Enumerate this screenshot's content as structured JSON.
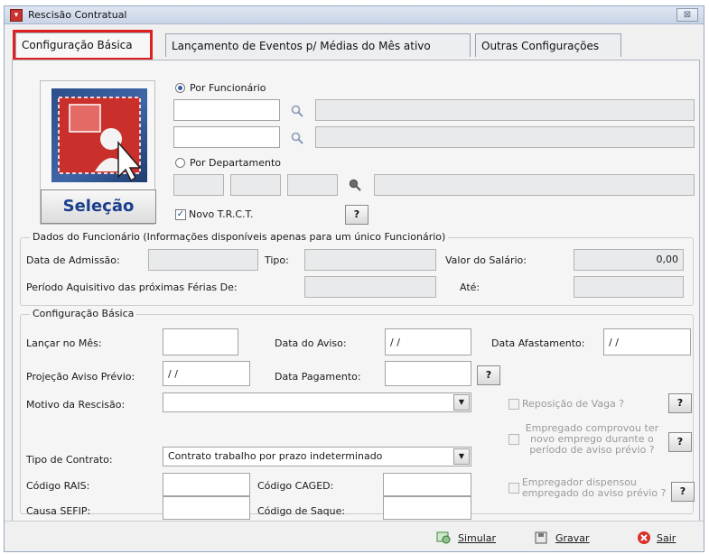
{
  "window": {
    "title": "Rescisão Contratual",
    "close_glyph": "⊠"
  },
  "tabs": [
    {
      "label": "Configuração Básica",
      "active": true
    },
    {
      "label": "Lançamento de Eventos p/ Médias do Mês ativo",
      "active": false
    },
    {
      "label": "Outras Configurações",
      "active": false
    }
  ],
  "selection": {
    "button_label": "Seleção"
  },
  "por_funcionario": {
    "label": "Por Funcionário",
    "checked": true,
    "code1": "",
    "code2": ""
  },
  "por_departamento": {
    "label": "Por Departamento",
    "checked": false
  },
  "novo_trct": {
    "label": "Novo T.R.C.T.",
    "checked": true
  },
  "help_label": "?",
  "dados_funcionario": {
    "title": "Dados do Funcionário (Informações disponíveis apenas para um único Funcionário)",
    "admissao_label": "Data de Admissão:",
    "tipo_label": "Tipo:",
    "salario_label": "Valor do Salário:",
    "salario_value": "0,00",
    "periodo_label": "Período Aquisitivo das próximas Férias De:",
    "ate_label": "Até:"
  },
  "config_basica": {
    "title": "Configuração Básica",
    "lancar_mes_label": "Lançar no Mês:",
    "data_aviso_label": "Data do Aviso:",
    "data_aviso_value": "/ /",
    "data_afastamento_label": "Data Afastamento:",
    "data_afastamento_value": "/ /",
    "projecao_label": "Projeção Aviso Prévio:",
    "projecao_value": "/ /",
    "data_pagamento_label": "Data Pagamento:",
    "motivo_label": "Motivo da Rescisão:",
    "motivo_value": "",
    "reposicao_label": "Reposição de Vaga ?",
    "empregado_comprovou_label": "Empregado comprovou ter novo emprego durante o período de aviso prévio ?",
    "tipo_contrato_label": "Tipo de Contrato:",
    "tipo_contrato_value": "Contrato trabalho por prazo indeterminado",
    "codigo_rais_label": "Código RAIS:",
    "codigo_caged_label": "Código CAGED:",
    "empregador_dispensou_label": "Empregador dispensou empregado do aviso prévio ?",
    "causa_sefip_label": "Causa SEFIP:",
    "codigo_saque_label": "Código de Saque:"
  },
  "footer": {
    "simular": "Simular",
    "gravar": "Gravar",
    "sair": "Sair"
  },
  "colors": {
    "accent": "#e02020",
    "brand_blue": "#1b3f8c"
  }
}
